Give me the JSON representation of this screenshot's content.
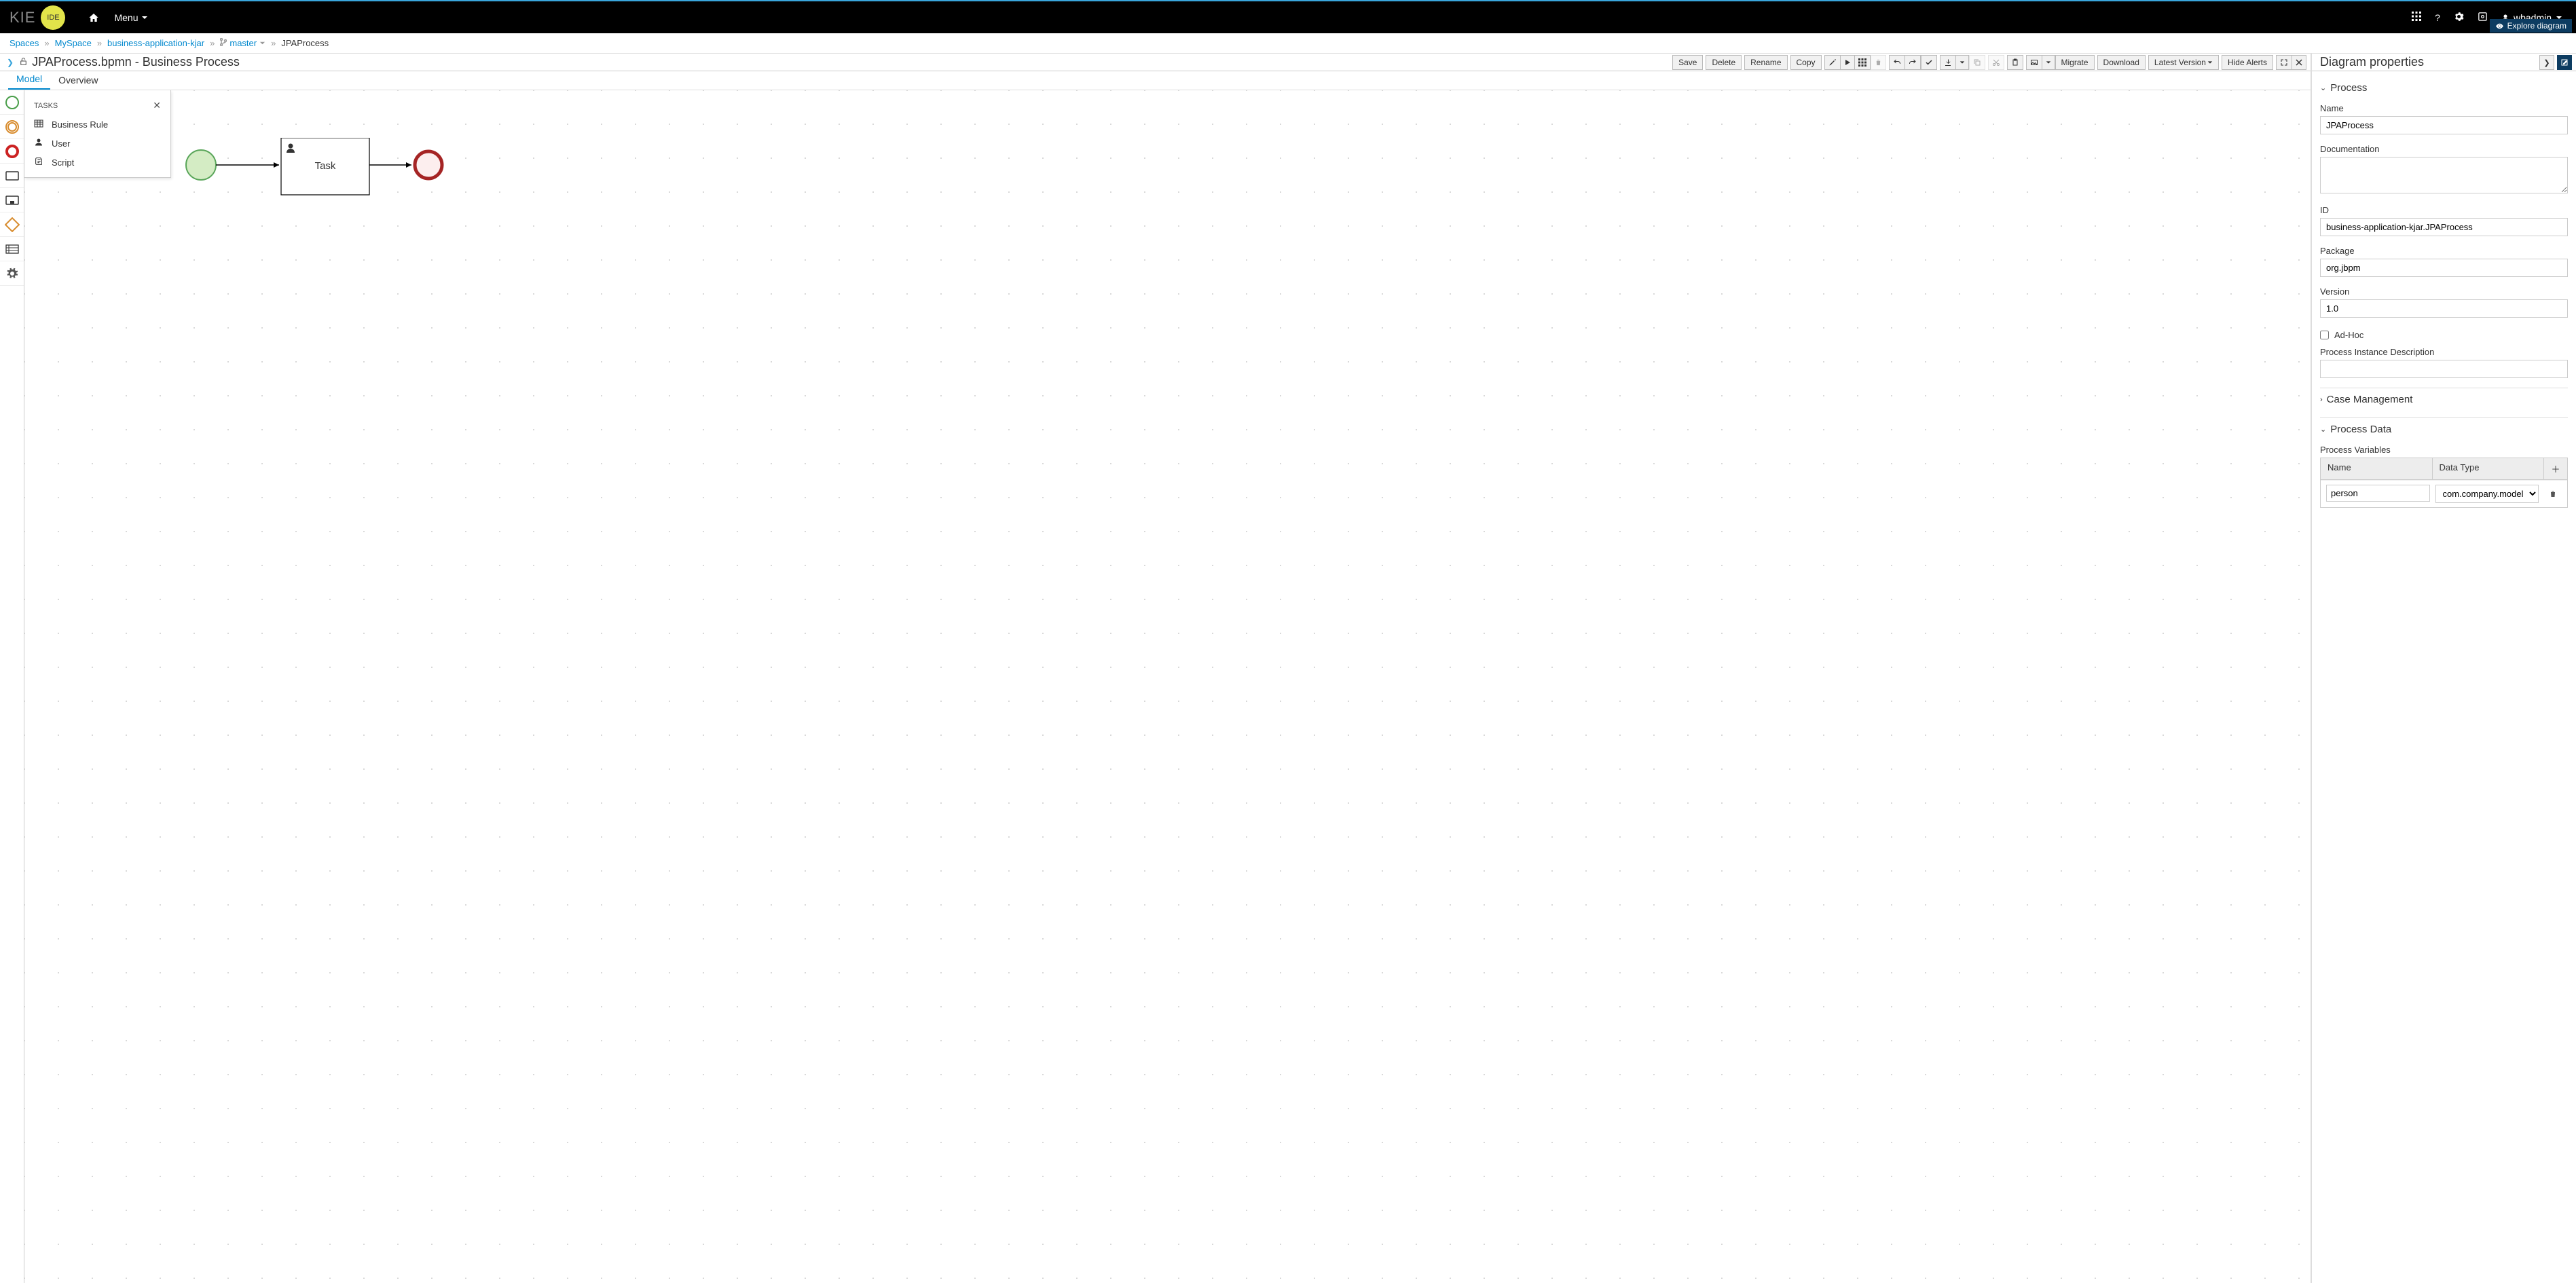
{
  "brand": {
    "kie": "KIE",
    "ide": "IDE"
  },
  "nav": {
    "menu": "Menu"
  },
  "user": {
    "name": "wbadmin"
  },
  "breadcrumb": {
    "spaces": "Spaces",
    "myspace": "MySpace",
    "project": "business-application-kjar",
    "branch": "master",
    "current": "JPAProcess"
  },
  "editor": {
    "title": "JPAProcess.bpmn - Business Process",
    "tabs": {
      "model": "Model",
      "overview": "Overview"
    }
  },
  "toolbar": {
    "save": "Save",
    "delete": "Delete",
    "rename": "Rename",
    "copy": "Copy",
    "migrate": "Migrate",
    "download": "Download",
    "latest": "Latest Version",
    "hideAlerts": "Hide Alerts"
  },
  "palette": {
    "popupTitle": "TASKS",
    "items": {
      "br": "Business Rule",
      "user": "User",
      "script": "Script"
    }
  },
  "diagram": {
    "taskLabel": "Task"
  },
  "props": {
    "title": "Diagram properties",
    "explore": "Explore diagram",
    "sections": {
      "process": "Process",
      "caseMgmt": "Case Management",
      "processData": "Process Data"
    },
    "labels": {
      "name": "Name",
      "documentation": "Documentation",
      "id": "ID",
      "package": "Package",
      "version": "Version",
      "adhoc": "Ad-Hoc",
      "pid": "Process Instance Description",
      "procVars": "Process Variables",
      "colName": "Name",
      "colDataType": "Data Type"
    },
    "values": {
      "name": "JPAProcess",
      "documentation": "",
      "id": "business-application-kjar.JPAProcess",
      "package": "org.jbpm",
      "version": "1.0",
      "pid": "",
      "varName": "person",
      "varType": "com.company.model."
    }
  }
}
